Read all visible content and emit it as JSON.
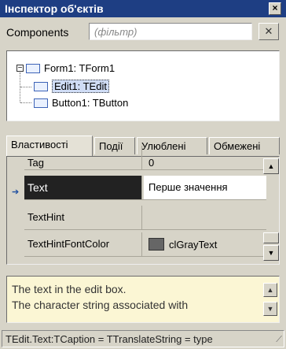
{
  "window": {
    "title": "Інспектор об'єктів",
    "close": "×"
  },
  "components": {
    "label": "Components",
    "filter_placeholder": "(фільтр)",
    "clear": "✕"
  },
  "tree": {
    "expander": "−",
    "nodes": [
      {
        "label": "Form1: TForm1"
      },
      {
        "label": "Edit1: TEdit"
      },
      {
        "label": "Button1: TButton"
      }
    ]
  },
  "tabs": [
    "Властивості",
    "Події",
    "Улюблені",
    "Обмежені"
  ],
  "properties": {
    "rows": [
      {
        "name": "Tag",
        "value": "0"
      },
      {
        "name": "Text",
        "value": "Перше значення"
      },
      {
        "name": "TextHint",
        "value": ""
      },
      {
        "name": "TextHintFontColor",
        "value": "clGrayText"
      }
    ],
    "marker": "➔"
  },
  "scroll": {
    "up": "▲",
    "down": "▼"
  },
  "hint": {
    "line1": "The text in the edit box.",
    "line2": "The character string associated with"
  },
  "status": {
    "text": "TEdit.Text:TCaption = TTranslateString = type"
  },
  "colors": {
    "titlebar": "#1e3e83",
    "hint_bg": "#fbf6d4",
    "swatch": "#666666"
  }
}
